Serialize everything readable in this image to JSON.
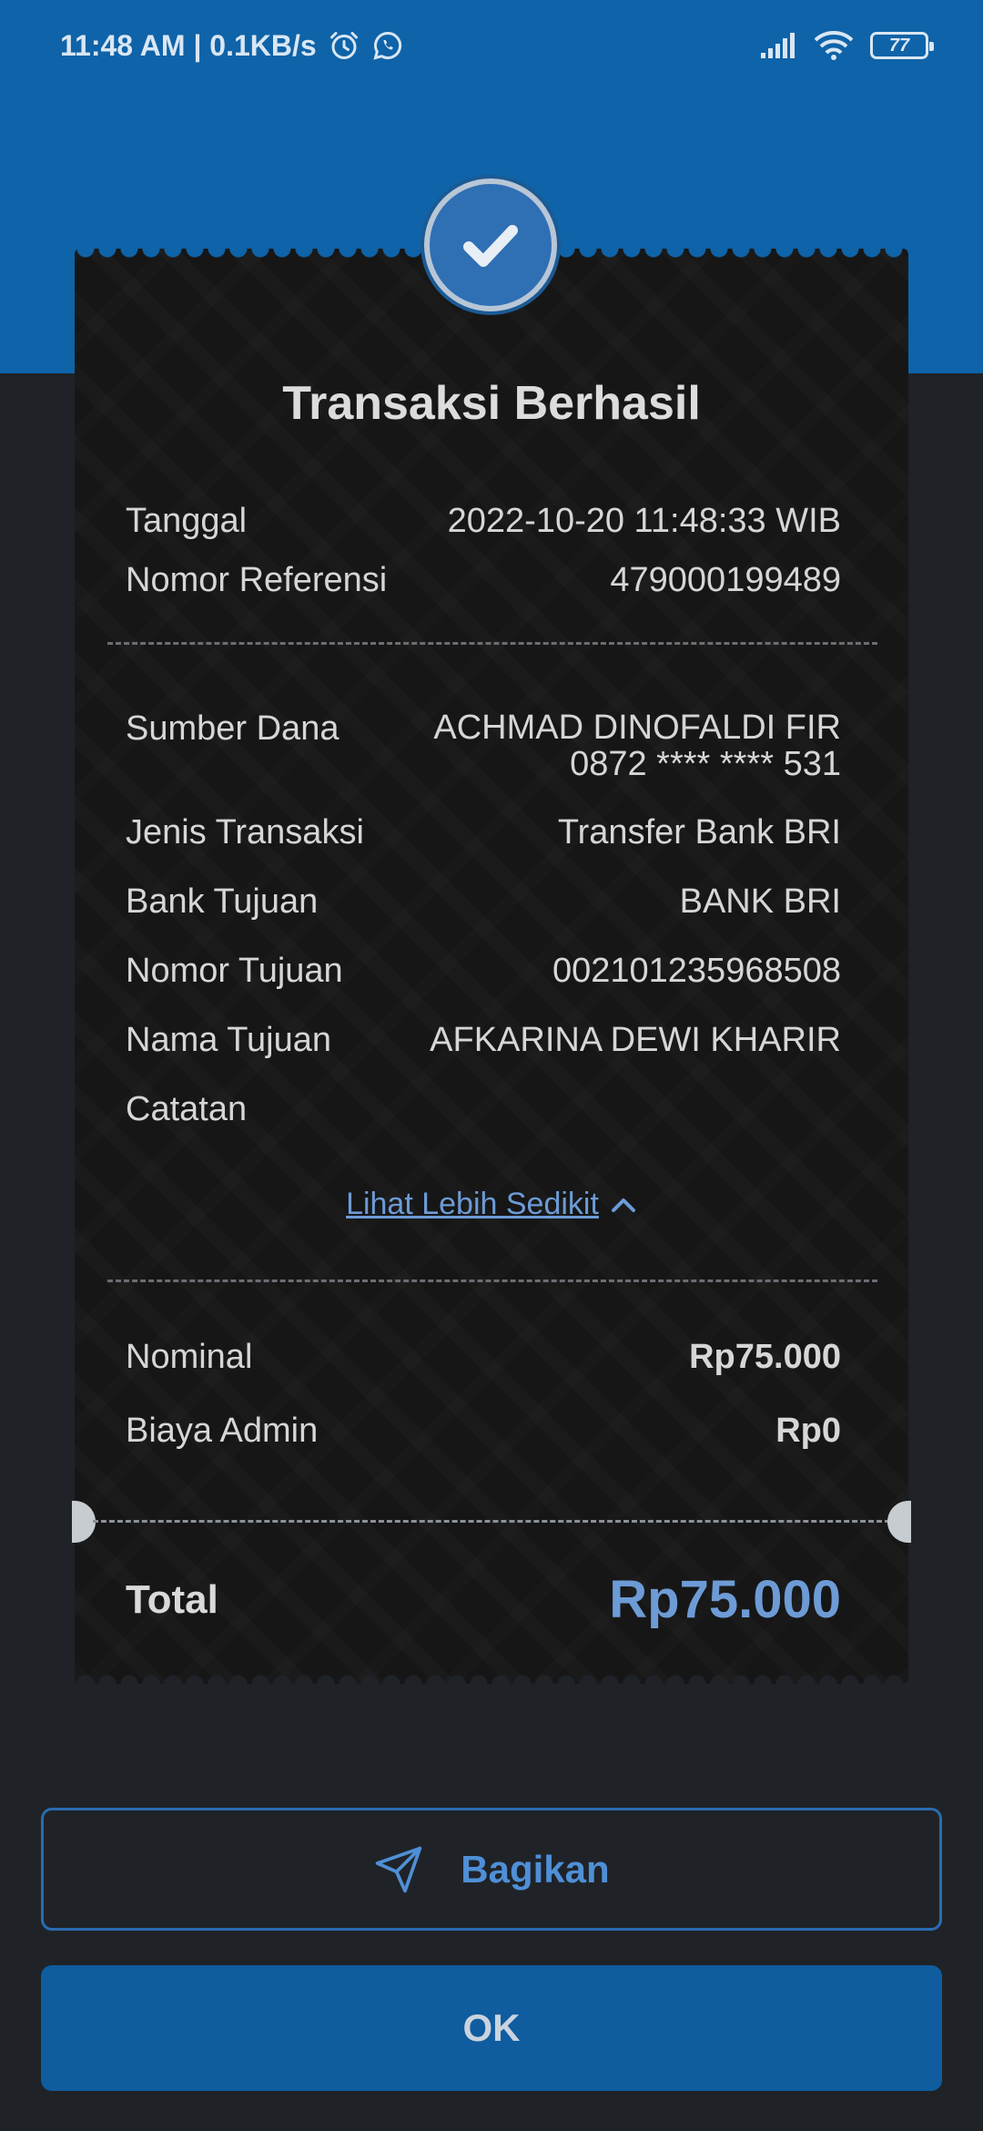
{
  "status_bar": {
    "time_speed": "11:48 AM | 0.1KB/s",
    "battery": "77",
    "icons": [
      "alarm-icon",
      "whatsapp-icon",
      "signal-icon",
      "wifi-icon",
      "battery-icon"
    ]
  },
  "receipt": {
    "title": "Transaksi Berhasil",
    "date_label": "Tanggal",
    "date_value": "2022-10-20 11:48:33 WIB",
    "ref_label": "Nomor Referensi",
    "ref_value": "479000199489",
    "source_label": "Sumber Dana",
    "source_name": "ACHMAD DINOFALDI FIR",
    "source_account": "0872 **** **** 531",
    "type_label": "Jenis Transaksi",
    "type_value": "Transfer Bank BRI",
    "bank_label": "Bank Tujuan",
    "bank_value": "BANK BRI",
    "dest_no_label": "Nomor Tujuan",
    "dest_no_value": "002101235968508",
    "dest_name_label": "Nama Tujuan",
    "dest_name_value": "AFKARINA DEWI KHARIR",
    "note_label": "Catatan",
    "see_less": "Lihat Lebih Sedikit",
    "nominal_label": "Nominal",
    "nominal_value": "Rp75.000",
    "admin_label": "Biaya Admin",
    "admin_value": "Rp0",
    "total_label": "Total",
    "total_value": "Rp75.000"
  },
  "buttons": {
    "share": "Bagikan",
    "ok": "OK"
  },
  "colors": {
    "brand_blue": "#0f63a8",
    "accent_link": "#6d9bd6",
    "background": "#1f2328",
    "receipt_bg": "#161616"
  }
}
